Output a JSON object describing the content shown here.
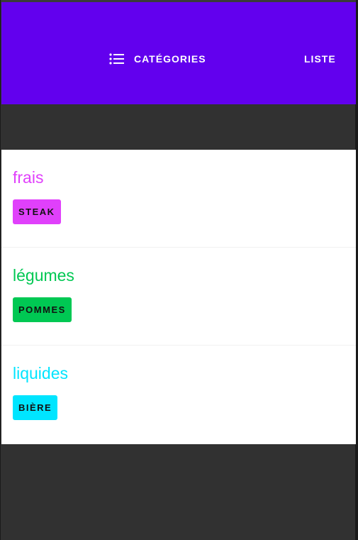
{
  "colors": {
    "appbar": "#6200ee",
    "background": "#313131",
    "frais": "#e040fb",
    "legumes": "#00c853",
    "liquides": "#00e5ff"
  },
  "nav": {
    "categories_icon": "list-icon",
    "categories_label": "CATÉGORIES",
    "liste_label": "LISTE"
  },
  "categories": [
    {
      "title": "frais",
      "items": [
        "STEAK"
      ]
    },
    {
      "title": "légumes",
      "items": [
        "POMMES"
      ]
    },
    {
      "title": "liquides",
      "items": [
        "BIÈRE"
      ]
    }
  ]
}
